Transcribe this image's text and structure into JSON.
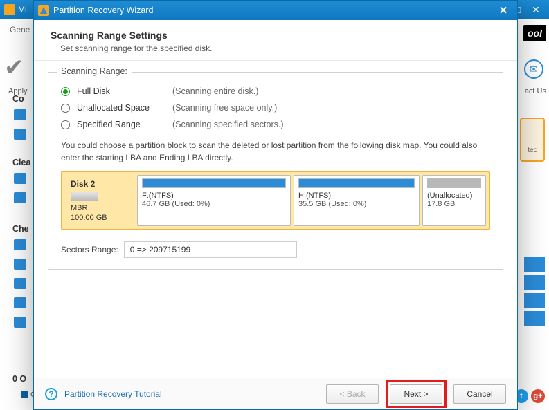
{
  "bg": {
    "title_fragment": "Mi",
    "tab": "Gene",
    "apply": "Apply",
    "sec1": "Co",
    "sec2": "Clea",
    "sec3": "Che",
    "footer": "0 O",
    "legend": "G",
    "right_logo": "ool",
    "right_txt": "act Us",
    "right_card": "tec"
  },
  "wizard": {
    "title": "Partition Recovery Wizard",
    "heading": "Scanning Range Settings",
    "subheading": "Set scanning range for the specified disk.",
    "group_title": "Scanning Range:",
    "radios": [
      {
        "label": "Full Disk",
        "desc": "(Scanning entire disk.)",
        "checked": true
      },
      {
        "label": "Unallocated Space",
        "desc": "(Scanning free space only.)",
        "checked": false
      },
      {
        "label": "Specified Range",
        "desc": "(Scanning specified sectors.)",
        "checked": false
      }
    ],
    "hint": "You could choose a partition block to scan the deleted or lost partition from the following disk map. You could also enter the starting LBA and Ending LBA directly.",
    "disk": {
      "name": "Disk 2",
      "type": "MBR",
      "size": "100.00 GB",
      "partitions": [
        {
          "label": "F:(NTFS)",
          "sub": "46.7 GB (Used: 0%)"
        },
        {
          "label": "H:(NTFS)",
          "sub": "35.5 GB (Used: 0%)"
        },
        {
          "label": "(Unallocated)",
          "sub": "17.8 GB"
        }
      ]
    },
    "sectors_label": "Sectors Range:",
    "sectors_value": "0 => 209715199",
    "help_link": "Partition Recovery Tutorial",
    "buttons": {
      "back": "< Back",
      "next": "Next >",
      "cancel": "Cancel"
    }
  }
}
